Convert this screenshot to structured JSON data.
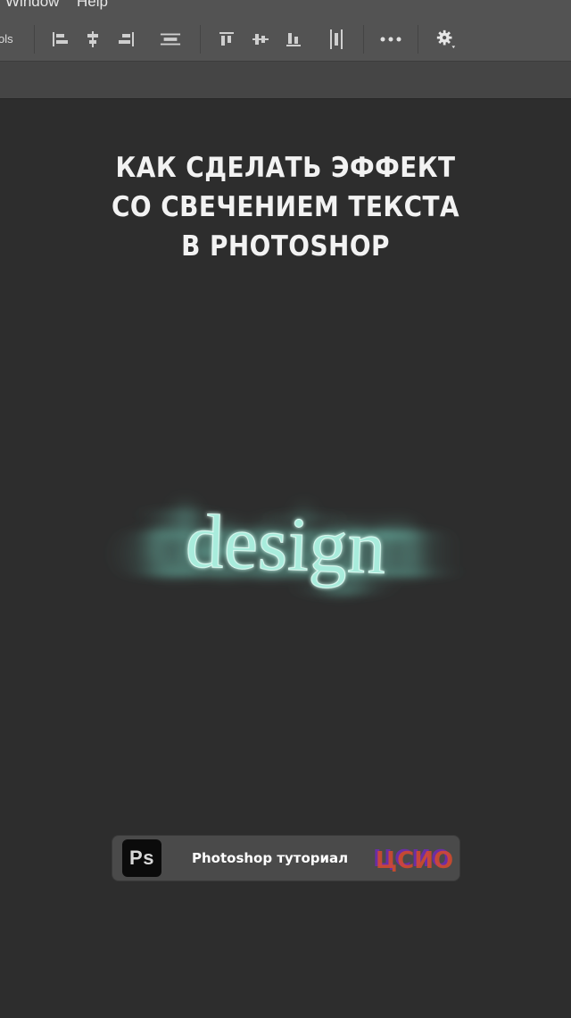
{
  "menu": {
    "items": [
      "Window",
      "Help"
    ]
  },
  "options_bar": {
    "label_fragment": "ols",
    "icons": [
      "align-left-edges-icon",
      "align-horizontal-centers-icon",
      "align-right-edges-icon",
      "distribute-horizontal-icon",
      "align-top-edges-icon",
      "align-vertical-centers-icon",
      "align-bottom-edges-icon",
      "distribute-vertical-icon",
      "more-options-icon",
      "settings-gear-icon"
    ]
  },
  "headline": {
    "line1": "КАК СДЕЛАТЬ ЭФФЕКТ",
    "line2": "СО СВЕЧЕНИЕМ ТЕКСТА",
    "line3": "В PHOTOSHOP"
  },
  "artwork": {
    "word": "design",
    "glow_color": "#8fe6d3"
  },
  "banner": {
    "logo_text": "Ps",
    "title": "Photoshop туториал",
    "brand": "ЦСИО",
    "brand_colors": [
      "#6a2fa3",
      "#e04a2a"
    ]
  }
}
